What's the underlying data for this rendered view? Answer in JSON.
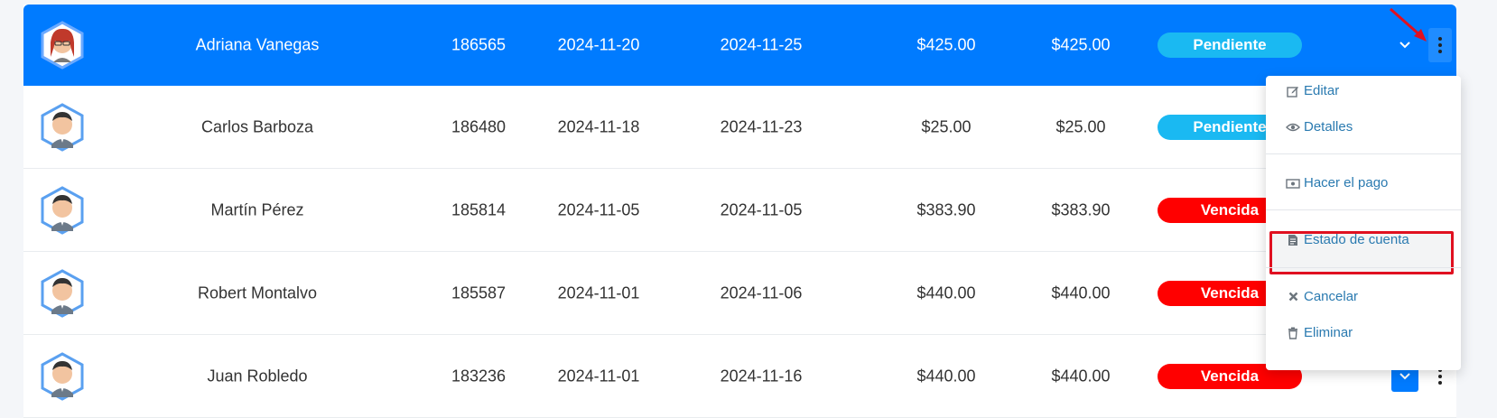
{
  "rows": [
    {
      "name": "Adriana Vanegas",
      "id": "186565",
      "date_issued": "2024-11-20",
      "date_due": "2024-11-25",
      "total": "$425.00",
      "balance": "$425.00",
      "status": "Pendiente",
      "status_type": "pending"
    },
    {
      "name": "Carlos Barboza",
      "id": "186480",
      "date_issued": "2024-11-18",
      "date_due": "2024-11-23",
      "total": "$25.00",
      "balance": "$25.00",
      "status": "Pendiente",
      "status_type": "pending"
    },
    {
      "name": "Martín Pérez",
      "id": "185814",
      "date_issued": "2024-11-05",
      "date_due": "2024-11-05",
      "total": "$383.90",
      "balance": "$383.90",
      "status": "Vencida",
      "status_type": "overdue"
    },
    {
      "name": "Robert Montalvo",
      "id": "185587",
      "date_issued": "2024-11-01",
      "date_due": "2024-11-06",
      "total": "$440.00",
      "balance": "$440.00",
      "status": "Vencida",
      "status_type": "overdue"
    },
    {
      "name": "Juan Robledo",
      "id": "183236",
      "date_issued": "2024-11-01",
      "date_due": "2024-11-16",
      "total": "$440.00",
      "balance": "$440.00",
      "status": "Vencida",
      "status_type": "overdue"
    }
  ],
  "menu": {
    "edit": "Editar",
    "details": "Detalles",
    "pay": "Hacer el pago",
    "statement": "Estado de cuenta",
    "cancel": "Cancelar",
    "delete": "Eliminar"
  },
  "icons": {
    "edit": "pencil-square-icon",
    "details": "eye-icon",
    "pay": "money-bill-icon",
    "statement": "file-text-icon",
    "cancel": "times-icon",
    "delete": "trash-icon",
    "row_expand": "chevron-down-icon",
    "row_actions": "kebab-menu-icon"
  },
  "colors": {
    "selected_row": "#007bff",
    "pending_badge": "#1ab9f2",
    "overdue_badge": "#ff0000",
    "menu_link": "#2a7ab0",
    "annotation": "#e01020"
  }
}
